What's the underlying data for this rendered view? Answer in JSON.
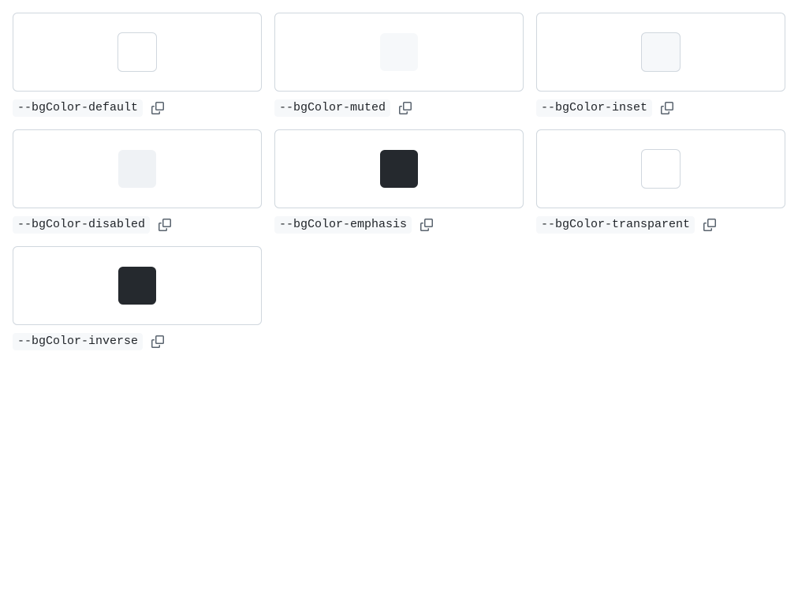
{
  "tokens": [
    {
      "name": "--bgColor-default",
      "color": "#ffffff",
      "bordered": true
    },
    {
      "name": "--bgColor-muted",
      "color": "#f6f8fa",
      "bordered": false
    },
    {
      "name": "--bgColor-inset",
      "color": "#f6f8fa",
      "bordered": true
    },
    {
      "name": "--bgColor-disabled",
      "color": "#eff2f5",
      "bordered": false
    },
    {
      "name": "--bgColor-emphasis",
      "color": "#25292e",
      "bordered": false
    },
    {
      "name": "--bgColor-transparent",
      "color": "#ffffff",
      "bordered": true
    },
    {
      "name": "--bgColor-inverse",
      "color": "#25292e",
      "bordered": false
    }
  ],
  "icons": {
    "copy": "copy-icon"
  },
  "colors": {
    "border": "#d0d7de",
    "label_bg": "#f6f8fa",
    "text": "#1f2328",
    "icon": "#59636e"
  }
}
